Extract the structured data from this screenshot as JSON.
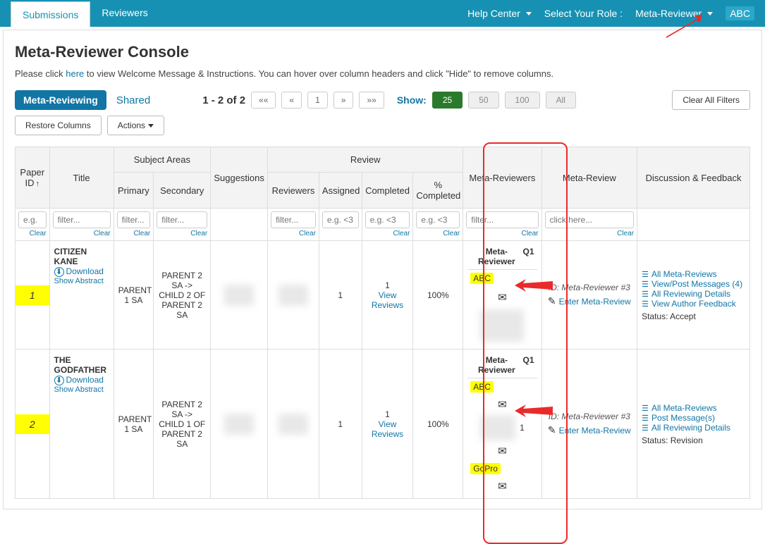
{
  "topbar": {
    "tabs": [
      "Submissions",
      "Reviewers"
    ],
    "help": "Help Center",
    "role_label": "Select Your Role :",
    "role_value": "Meta-Reviewer",
    "username": "ABC"
  },
  "page": {
    "title": "Meta-Reviewer Console",
    "instr_pre": "Please click ",
    "instr_link": "here",
    "instr_post": " to view Welcome Message & Instructions. You can hover over column headers and click \"Hide\" to remove columns."
  },
  "toolbar": {
    "tab_active": "Meta-Reviewing",
    "tab_shared": "Shared",
    "pager_text": "1 - 2 of 2",
    "pg_first": "««",
    "pg_prev": "«",
    "pg_1": "1",
    "pg_next": "»",
    "pg_last": "»»",
    "show_label": "Show:",
    "show_25": "25",
    "show_50": "50",
    "show_100": "100",
    "show_all": "All",
    "clear_filters": "Clear All Filters",
    "restore_cols": "Restore Columns",
    "actions": "Actions"
  },
  "headers": {
    "paper_id": "Paper ID",
    "title": "Title",
    "subject_areas": "Subject Areas",
    "primary": "Primary",
    "secondary": "Secondary",
    "review": "Review",
    "suggestions": "Suggestions",
    "reviewers": "Reviewers",
    "assigned": "Assigned",
    "completed": "Completed",
    "pct": "% Completed",
    "meta_reviewers": "Meta-Reviewers",
    "meta_review": "Meta-Review",
    "discussion": "Discussion & Feedback",
    "clear": "Clear"
  },
  "filters": {
    "eg": "e.g.",
    "filter": "filter...",
    "eg3": "e.g. <3",
    "click": "click here..."
  },
  "rows": [
    {
      "id": "1",
      "title": "CITIZEN KANE",
      "download": "Download",
      "abstract": "Show Abstract",
      "primary": "PARENT 1 SA",
      "secondary": "PARENT 2 SA -> CHILD 2 OF PARENT 2 SA",
      "assigned": "1",
      "completed_n": "1",
      "view_reviews": "View Reviews",
      "pct": "100%",
      "mr_label": "Meta-Reviewer",
      "mr_q": "Q1",
      "mr_name": "ABC",
      "meta_id": "ID: Meta-Reviewer #3",
      "enter": "Enter Meta-Review",
      "links": {
        "all": "All Meta-Reviews",
        "post": "View/Post Messages (4)",
        "details": "All Reviewing Details",
        "author": "View Author Feedback"
      },
      "status": "Status: Accept"
    },
    {
      "id": "2",
      "title": "THE GODFATHER",
      "download": "Download",
      "abstract": "Show Abstract",
      "primary": "PARENT 1 SA",
      "secondary": "PARENT 2 SA -> CHILD 1 OF PARENT 2 SA",
      "assigned": "1",
      "completed_n": "1",
      "view_reviews": "View Reviews",
      "pct": "100%",
      "mr_label": "Meta-Reviewer",
      "mr_q": "Q1",
      "mr_name": "ABC",
      "mr_extra_count": "1",
      "mr_extra_name": "GoPro",
      "meta_id": "ID: Meta-Reviewer #3",
      "enter": "Enter Meta-Review",
      "links": {
        "all": "All Meta-Reviews",
        "post": "Post Message(s)",
        "details": "All Reviewing Details"
      },
      "status": "Status: Revision"
    }
  ]
}
